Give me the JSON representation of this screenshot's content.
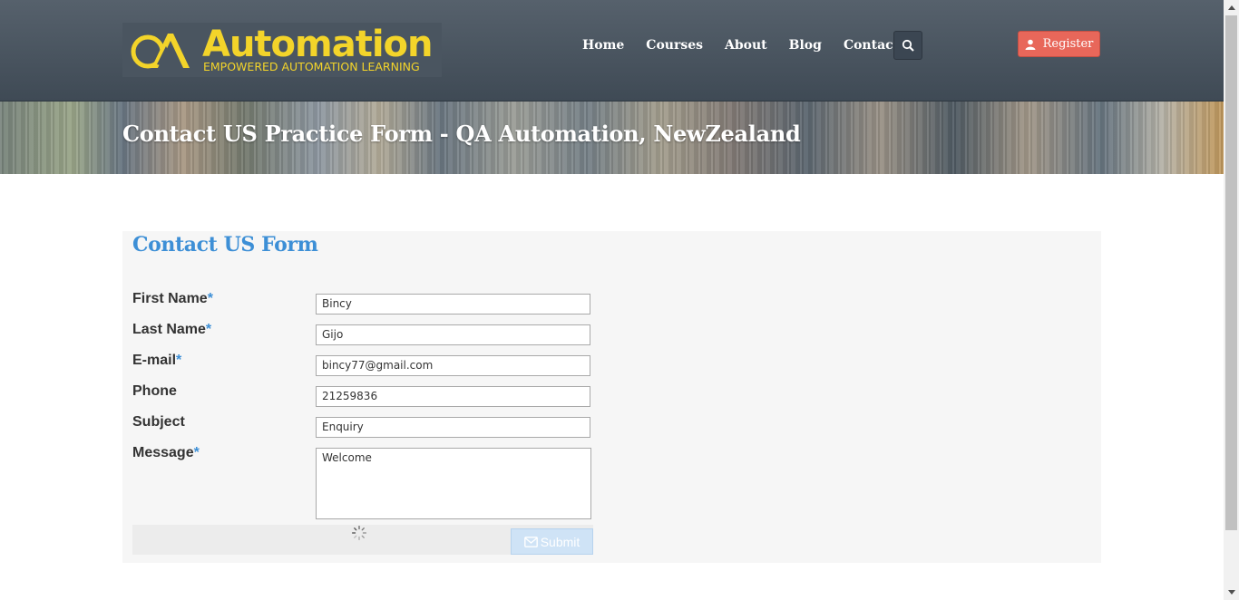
{
  "header": {
    "logo": {
      "word": "Automation",
      "tagline": "EMPOWERED AUTOMATION LEARNING"
    },
    "nav": [
      "Home",
      "Courses",
      "About",
      "Blog",
      "Contact Us"
    ],
    "register_label": "Register"
  },
  "banner": {
    "title": "Contact US Practice Form - QA Automation, NewZealand"
  },
  "form": {
    "title": "Contact US Form",
    "required_mark": "*",
    "first_name": {
      "label": "First Name",
      "value": "Bincy"
    },
    "last_name": {
      "label": "Last Name",
      "value": "Gijo"
    },
    "email": {
      "label": "E-mail",
      "value": "bincy77@gmail.com"
    },
    "phone": {
      "label": "Phone",
      "value": "21259836"
    },
    "subject": {
      "label": "Subject",
      "value": "Enquiry"
    },
    "message": {
      "label": "Message",
      "value": "Welcome"
    },
    "submit_label": "Submit"
  },
  "colors": {
    "accent": "#3d8fd6",
    "register": "#e8675a",
    "logo": "#f3d42a",
    "header": "#4a5560"
  }
}
